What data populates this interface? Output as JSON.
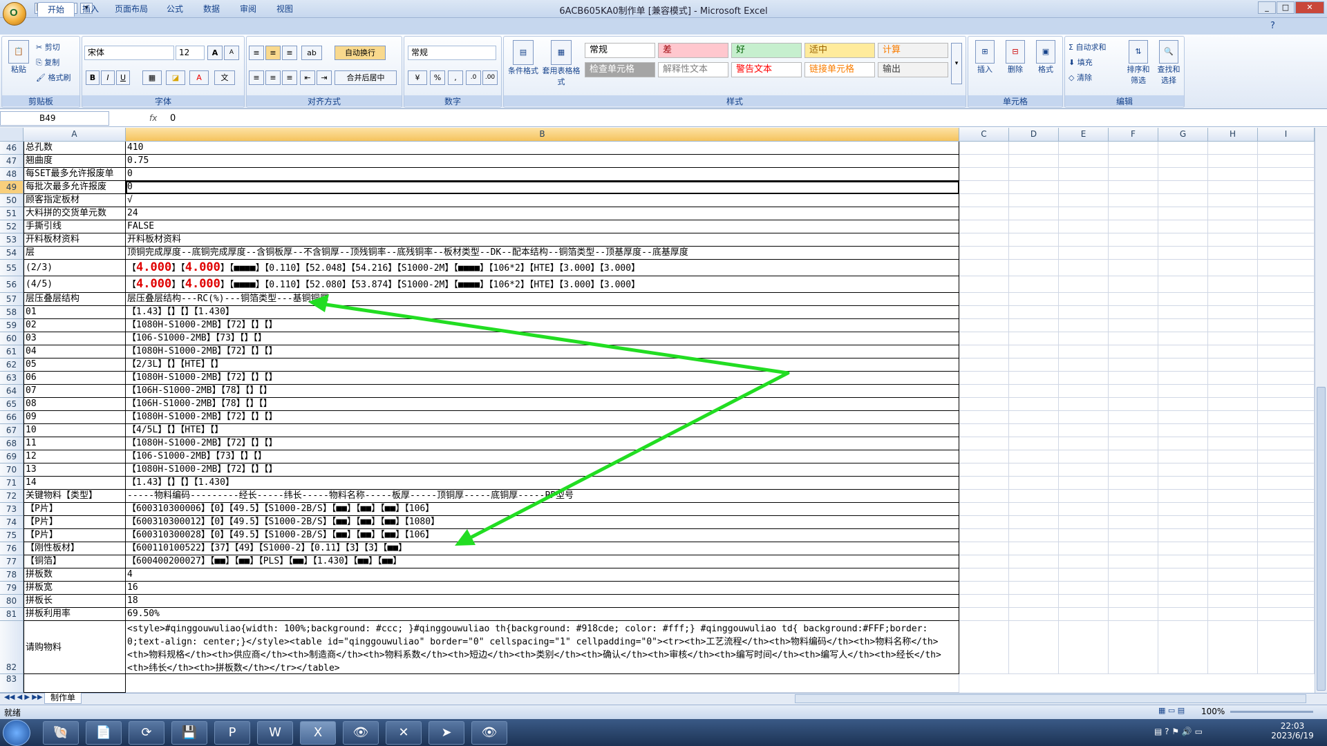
{
  "window": {
    "title": "6ACB605KA0制作单  [兼容模式] - Microsoft Excel"
  },
  "orb": {
    "label": "O"
  },
  "qat": [
    "💾",
    "↶",
    "↷",
    "▾"
  ],
  "tabs": [
    "开始",
    "插入",
    "页面布局",
    "公式",
    "数据",
    "审阅",
    "视图"
  ],
  "clipboard": {
    "paste": "粘贴",
    "cut": "剪切",
    "copy": "复制",
    "format": "格式刷",
    "group": "剪贴板"
  },
  "font": {
    "name": "宋体",
    "size": "12",
    "grow": "A",
    "shrink": "A",
    "bold": "B",
    "italic": "I",
    "underline": "U",
    "group": "字体"
  },
  "align": {
    "wrap": "自动换行",
    "merge": "合并后居中",
    "group": "对齐方式"
  },
  "number": {
    "format": "常规",
    "pct": "%",
    "comma": ",",
    "group": "数字"
  },
  "styles": {
    "cond": "条件格式",
    "table": "套用表格格式",
    "group": "样式",
    "boxes": [
      {
        "label": "常规",
        "bg": "#ffffff",
        "fg": "#000000"
      },
      {
        "label": "差",
        "bg": "#ffc7ce",
        "fg": "#9c0006"
      },
      {
        "label": "好",
        "bg": "#c6efce",
        "fg": "#006100"
      },
      {
        "label": "适中",
        "bg": "#ffeb9c",
        "fg": "#9c6500"
      },
      {
        "label": "计算",
        "bg": "#f2f2f2",
        "fg": "#fa7d00"
      },
      {
        "label": "检查单元格",
        "bg": "#a5a5a5",
        "fg": "#ffffff"
      },
      {
        "label": "解释性文本",
        "bg": "#ffffff",
        "fg": "#7f7f7f"
      },
      {
        "label": "警告文本",
        "bg": "#ffffff",
        "fg": "#ff0000"
      },
      {
        "label": "链接单元格",
        "bg": "#ffffff",
        "fg": "#fa7d00"
      },
      {
        "label": "输出",
        "bg": "#f2f2f2",
        "fg": "#3f3f3f"
      }
    ]
  },
  "cells": {
    "insert": "插入",
    "delete": "删除",
    "format": "格式",
    "group": "单元格"
  },
  "editing": {
    "autosum": "Σ 自动求和",
    "fill": "填充",
    "clear": "清除",
    "sort": "排序和筛选",
    "find": "查找和选择",
    "group": "编辑"
  },
  "formula_bar": {
    "namebox": "B49",
    "fx": "fx",
    "value": "0"
  },
  "columns": [
    "A",
    "B",
    "C",
    "D",
    "E",
    "F",
    "G",
    "H",
    "I"
  ],
  "rows": [
    {
      "n": "46",
      "a": "总孔数",
      "b": "410"
    },
    {
      "n": "47",
      "a": "翘曲度",
      "b": "0.75"
    },
    {
      "n": "48",
      "a": "每SET最多允许报废单",
      "b": "0"
    },
    {
      "n": "49",
      "a": "每批次最多允许报废",
      "b": "0"
    },
    {
      "n": "50",
      "a": "顾客指定板材",
      "b": "√"
    },
    {
      "n": "51",
      "a": "大料拼的交货单元数",
      "b": "24"
    },
    {
      "n": "52",
      "a": "手撕引线",
      "b": "FALSE"
    },
    {
      "n": "53",
      "a": "开料板材资料",
      "b": "开料板材资料"
    },
    {
      "n": "54",
      "a": "层",
      "b": "顶铜完成厚度--底铜完成厚度--含铜板厚--不含铜厚--顶残铜率--底残铜率--板材类型--DK--配本结构--铜箔类型--顶基厚度--底基厚度"
    },
    {
      "n": "55",
      "a": "(2/3)",
      "b1": "【",
      "r1": "4.000",
      "b2": "】【",
      "r2": "4.000",
      "b3": "】【■■■■】【0.110】【52.048】【54.216】【S1000-2M】【■■■■】【106*2】【HTE】【3.000】【3.000】"
    },
    {
      "n": "56",
      "a": "(4/5)",
      "b1": "【",
      "r1": "4.000",
      "b2": "】【",
      "r2": "4.000",
      "b3": "】【■■■■】【0.110】【52.080】【53.874】【S1000-2M】【■■■■】【106*2】【HTE】【3.000】【3.000】"
    },
    {
      "n": "57",
      "a": "层压叠层结构",
      "b": "层压叠层结构---RC(%)---铜箔类型---基铜铜厚"
    },
    {
      "n": "58",
      "a": "01",
      "b": "【1.43】【】【】【1.430】"
    },
    {
      "n": "59",
      "a": "02",
      "b": "【1080H-S1000-2MB】【72】【】【】"
    },
    {
      "n": "60",
      "a": "03",
      "b": "【106-S1000-2MB】【73】【】【】"
    },
    {
      "n": "61",
      "a": "04",
      "b": "【1080H-S1000-2MB】【72】【】【】"
    },
    {
      "n": "62",
      "a": "05",
      "b": "【2/3L】【】【HTE】【】"
    },
    {
      "n": "63",
      "a": "06",
      "b": "【1080H-S1000-2MB】【72】【】【】"
    },
    {
      "n": "64",
      "a": "07",
      "b": "【106H-S1000-2MB】【78】【】【】"
    },
    {
      "n": "65",
      "a": "08",
      "b": "【106H-S1000-2MB】【78】【】【】"
    },
    {
      "n": "66",
      "a": "09",
      "b": "【1080H-S1000-2MB】【72】【】【】"
    },
    {
      "n": "67",
      "a": "10",
      "b": "【4/5L】【】【HTE】【】"
    },
    {
      "n": "68",
      "a": "11",
      "b": "【1080H-S1000-2MB】【72】【】【】"
    },
    {
      "n": "69",
      "a": "12",
      "b": "【106-S1000-2MB】【73】【】【】"
    },
    {
      "n": "70",
      "a": "13",
      "b": "【1080H-S1000-2MB】【72】【】【】"
    },
    {
      "n": "71",
      "a": "14",
      "b": "【1.43】【】【】【1.430】"
    },
    {
      "n": "72",
      "a": "关键物料【类型】",
      "b": "-----物料编码---------经长-----纬长-----物料名称-----板厚-----顶铜厚-----底铜厚-----PP型号"
    },
    {
      "n": "73",
      "a": "【P片】",
      "b": "【600310300006】【0】【49.5】【S1000-2B/S】【■■】【■■】【■■】【106】"
    },
    {
      "n": "74",
      "a": "【P片】",
      "b": "【600310300012】【0】【49.5】【S1000-2B/S】【■■】【■■】【■■】【1080】"
    },
    {
      "n": "75",
      "a": "【P片】",
      "b": "【600310300028】【0】【49.5】【S1000-2B/S】【■■】【■■】【■■】【106】"
    },
    {
      "n": "76",
      "a": "【刚性板材】",
      "b": "【600110100522】【37】【49】【S1000-2】【0.11】【3】【3】【■■】"
    },
    {
      "n": "77",
      "a": "【铜箔】",
      "b": "【600400200027】【■■】【■■】【PLS】【■■】【1.430】【■■】【■■】"
    },
    {
      "n": "78",
      "a": "拼板数",
      "b": "4"
    },
    {
      "n": "79",
      "a": "拼板宽",
      "b": "16"
    },
    {
      "n": "80",
      "a": "拼板长",
      "b": "18"
    },
    {
      "n": "81",
      "a": "拼板利用率",
      "b": "69.50%"
    }
  ],
  "row82": {
    "n": "82",
    "a": "请购物料",
    "b": "<style>#qinggouwuliao{width: 100%;background: #ccc; }#qinggouwuliao th{background: #918cde; color: #fff;} #qinggouwuliao td{ background:#FFF;border: 0;text-align: center;}</style><table id=\"qinggouwuliao\" border=\"0\" cellspacing=\"1\" cellpadding=\"0\"><tr><th>工艺流程</th><th>物料编码</th><th>物料名称</th><th>物料规格</th><th>供应商</th><th>制造商</th><th>物料系数</th><th>短边</th><th>类别</th><th>确认</th><th>审核</th><th>编写时间</th><th>编写人</th><th>经长</th><th>纬长</th><th>拼板数</th></tr></table>"
  },
  "row83": {
    "n": "83"
  },
  "sheet_tab": "制作单",
  "status": {
    "ready": "就绪",
    "zoom": "100%"
  },
  "clock": {
    "time": "22:03",
    "date": "2023/6/19"
  },
  "colors": {
    "arrow": "#22dd22",
    "selected_col": "#f5c35d",
    "accent": "#15428b"
  }
}
